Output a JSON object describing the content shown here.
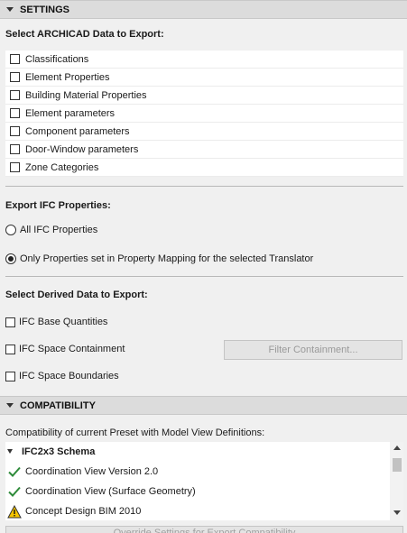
{
  "settings": {
    "header": "SETTINGS",
    "archicad_label": "Select ARCHICAD Data to Export:",
    "archicad_items": [
      {
        "label": "Classifications",
        "checked": false
      },
      {
        "label": "Element Properties",
        "checked": false
      },
      {
        "label": "Building Material Properties",
        "checked": false
      },
      {
        "label": "Element parameters",
        "checked": false
      },
      {
        "label": "Component parameters",
        "checked": false
      },
      {
        "label": "Door-Window parameters",
        "checked": false
      },
      {
        "label": "Zone Categories",
        "checked": false
      }
    ],
    "ifc_label": "Export IFC Properties:",
    "ifc_options": [
      {
        "label": "All IFC Properties",
        "selected": false
      },
      {
        "label": "Only Properties set in Property Mapping for the selected Translator",
        "selected": true
      }
    ],
    "derived_label": "Select Derived Data to Export:",
    "derived_items": [
      {
        "label": "IFC Base Quantities",
        "checked": false
      },
      {
        "label": "IFC Space Containment",
        "checked": false
      },
      {
        "label": "IFC Space Boundaries",
        "checked": false
      }
    ],
    "filter_button": "Filter Containment..."
  },
  "compatibility": {
    "header": "COMPATIBILITY",
    "description": "Compatibility of current Preset with Model View Definitions:",
    "group": "IFC2x3 Schema",
    "items": [
      {
        "label": "Coordination View Version 2.0",
        "status": "check-icon"
      },
      {
        "label": "Coordination View (Surface Geometry)",
        "status": "check-icon"
      },
      {
        "label": "Concept Design BIM 2010",
        "status": "warning-icon"
      }
    ],
    "override_button": "Override Settings for Export Compatibility",
    "colors": {
      "check": "#2e8b3a",
      "warning_fill": "#f5c400"
    }
  }
}
